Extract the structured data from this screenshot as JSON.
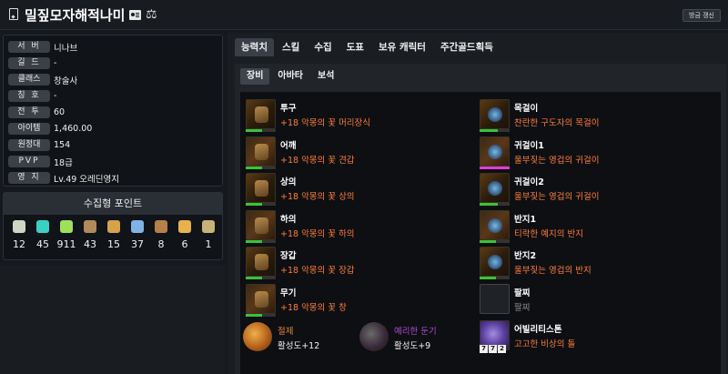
{
  "header": {
    "character_name": "밀짚모자해적나미",
    "refresh_label": "방금 갱신"
  },
  "profile": {
    "rows": [
      {
        "label": "서 버",
        "value": "니나브"
      },
      {
        "label": "길 드",
        "value": "-"
      },
      {
        "label": "클래스",
        "value": "창술사"
      },
      {
        "label": "칭 호",
        "value": "-"
      },
      {
        "label": "전 투",
        "value": "60"
      },
      {
        "label": "아이템",
        "value": "1,460.00"
      },
      {
        "label": "원정대",
        "value": "154"
      },
      {
        "label": "PVP",
        "value": "18급"
      },
      {
        "label": "영 지",
        "value": "Lv.49 오레딘영지"
      }
    ]
  },
  "collection": {
    "title": "수집형 포인트",
    "items": [
      {
        "icon": "mokoko-seed-icon",
        "color": "#cfd6c4",
        "count": "12"
      },
      {
        "icon": "island-heart-icon",
        "color": "#39d1c6",
        "count": "45"
      },
      {
        "icon": "mokoko-seed-green-icon",
        "color": "#9fe05a",
        "count": "911"
      },
      {
        "icon": "treasure-map-icon",
        "color": "#b08a5a",
        "count": "43"
      },
      {
        "icon": "ignea-token-icon",
        "color": "#d6a24a",
        "count": "15"
      },
      {
        "icon": "world-tree-leaf-icon",
        "color": "#7fb3e8",
        "count": "37"
      },
      {
        "icon": "orpheus-star-icon",
        "color": "#b5804a",
        "count": "8"
      },
      {
        "icon": "giant-heart-icon",
        "color": "#e8b24a",
        "count": "6"
      },
      {
        "icon": "masterpiece-icon",
        "color": "#c9b27a",
        "count": "1"
      }
    ]
  },
  "tabs": [
    "능력치",
    "스킬",
    "수집",
    "도표",
    "보유 캐릭터",
    "주간골드획득"
  ],
  "active_tab": "능력치",
  "subtabs": [
    "장비",
    "아바타",
    "보석"
  ],
  "active_subtab": "장비",
  "equipment_left": [
    {
      "name": "투구",
      "desc": "+18 악몽의 꽃 머리장식",
      "quality": 0.55,
      "bar": "green",
      "icon": "helmet-icon"
    },
    {
      "name": "어깨",
      "desc": "+18 악몽의 꽃 견갑",
      "quality": 0.55,
      "bar": "green",
      "icon": "shoulder-icon"
    },
    {
      "name": "상의",
      "desc": "+18 악몽의 꽃 상의",
      "quality": 0.55,
      "bar": "green",
      "icon": "chest-armor-icon"
    },
    {
      "name": "하의",
      "desc": "+18 악몽의 꽃 하의",
      "quality": 0.55,
      "bar": "green",
      "icon": "pants-icon"
    },
    {
      "name": "장갑",
      "desc": "+18 악몽의 꽃 장갑",
      "quality": 0.55,
      "bar": "green",
      "icon": "gloves-icon"
    },
    {
      "name": "무기",
      "desc": "+18 악몽의 꽃 창",
      "quality": 0.55,
      "bar": "green",
      "icon": "spear-weapon-icon"
    }
  ],
  "equipment_right": [
    {
      "name": "목걸이",
      "desc": "찬란한 구도자의 목걸이",
      "quality": 0.6,
      "bar": "green",
      "icon": "necklace-icon"
    },
    {
      "name": "귀걸이1",
      "desc": "울부짖는 영겁의 귀걸이",
      "quality": 1.0,
      "bar": "pink",
      "icon": "earring-icon"
    },
    {
      "name": "귀걸이2",
      "desc": "울부짖는 영겁의 귀걸이",
      "quality": 0.6,
      "bar": "green",
      "icon": "earring-icon"
    },
    {
      "name": "반지1",
      "desc": "티락한 예지의 반지",
      "quality": 0.55,
      "bar": "green",
      "icon": "ring-icon"
    },
    {
      "name": "반지2",
      "desc": "울부짖는 영겁의 반지",
      "quality": 0.55,
      "bar": "green",
      "icon": "ring-icon"
    },
    {
      "name": "팔찌",
      "desc": "팔찌",
      "quality": 0,
      "bar": "none",
      "icon": "bracelet-icon"
    },
    {
      "name": "어빌리티스톤",
      "desc": "고고한 비상의 돌",
      "quality": 0,
      "bar": "none",
      "icon": "ability-stone-icon",
      "badges": [
        "7",
        "7",
        "2"
      ]
    }
  ],
  "engravings": [
    {
      "name": "절제",
      "level": "활성도+12",
      "name_color": "#e0873a",
      "icon": "restraint-engraving-icon"
    },
    {
      "name": "예리한 둔기",
      "level": "활성도+9",
      "name_color": "#b24ad6",
      "icon": "keen-blunt-engraving-icon"
    }
  ]
}
